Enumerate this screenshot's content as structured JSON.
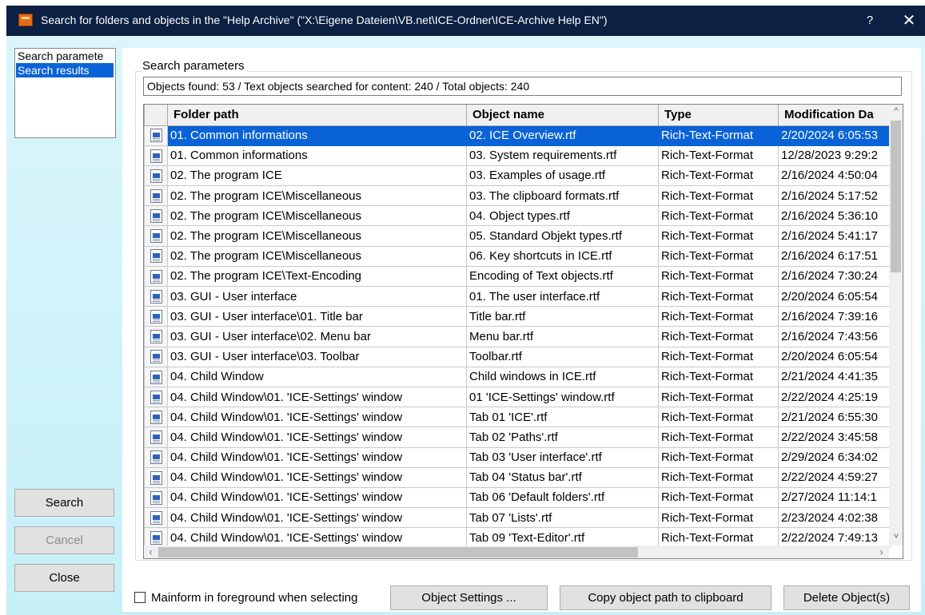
{
  "window": {
    "title": "Search for folders and objects in the \"Help Archive\" (\"X:\\Eigene Dateien\\VB.net\\ICE-Ordner\\ICE-Archive Help EN\")",
    "help_glyph": "?",
    "close_glyph": "✕"
  },
  "nav": {
    "items": [
      {
        "label": "Search paramete"
      },
      {
        "label": "Search results"
      }
    ],
    "selected_index": 1
  },
  "side_buttons": {
    "search": "Search",
    "cancel": "Cancel",
    "close": "Close"
  },
  "group_caption": "Search parameters",
  "status_line": "Objects found: 53 / Text objects searched for content: 240 / Total objects: 240",
  "table": {
    "columns": [
      "Folder path",
      "Object name",
      "Type",
      "Modification Da"
    ],
    "rows": [
      [
        "01. Common informations",
        "02. ICE Overview.rtf",
        "Rich-Text-Format",
        "2/20/2024 6:05:53"
      ],
      [
        "01. Common informations",
        "03. System requirements.rtf",
        "Rich-Text-Format",
        "12/28/2023 9:29:2"
      ],
      [
        "02. The program ICE",
        "03. Examples of usage.rtf",
        "Rich-Text-Format",
        "2/16/2024 4:50:04"
      ],
      [
        "02. The program ICE\\Miscellaneous",
        "03. The clipboard formats.rtf",
        "Rich-Text-Format",
        "2/16/2024 5:17:52"
      ],
      [
        "02. The program ICE\\Miscellaneous",
        "04. Object types.rtf",
        "Rich-Text-Format",
        "2/16/2024 5:36:10"
      ],
      [
        "02. The program ICE\\Miscellaneous",
        "05. Standard Objekt types.rtf",
        "Rich-Text-Format",
        "2/16/2024 5:41:17"
      ],
      [
        "02. The program ICE\\Miscellaneous",
        "06. Key shortcuts in ICE.rtf",
        "Rich-Text-Format",
        "2/16/2024 6:17:51"
      ],
      [
        "02. The program ICE\\Text-Encoding",
        "Encoding of Text objects.rtf",
        "Rich-Text-Format",
        "2/16/2024 7:30:24"
      ],
      [
        "03. GUI - User interface",
        "01. The user interface.rtf",
        "Rich-Text-Format",
        "2/20/2024 6:05:54"
      ],
      [
        "03. GUI - User interface\\01. Title bar",
        "Title bar.rtf",
        "Rich-Text-Format",
        "2/16/2024 7:39:16"
      ],
      [
        "03. GUI - User interface\\02. Menu bar",
        "Menu bar.rtf",
        "Rich-Text-Format",
        "2/16/2024 7:43:56"
      ],
      [
        "03. GUI - User interface\\03. Toolbar",
        "Toolbar.rtf",
        "Rich-Text-Format",
        "2/20/2024 6:05:54"
      ],
      [
        "04. Child Window",
        "Child windows in ICE.rtf",
        "Rich-Text-Format",
        "2/21/2024 4:41:35"
      ],
      [
        "04. Child Window\\01. 'ICE-Settings' window",
        "01 'ICE-Settings' window.rtf",
        "Rich-Text-Format",
        "2/22/2024 4:25:19"
      ],
      [
        "04. Child Window\\01. 'ICE-Settings' window",
        "Tab 01 'ICE'.rtf",
        "Rich-Text-Format",
        "2/21/2024 6:55:30"
      ],
      [
        "04. Child Window\\01. 'ICE-Settings' window",
        "Tab 02 'Paths'.rtf",
        "Rich-Text-Format",
        "2/22/2024 3:45:58"
      ],
      [
        "04. Child Window\\01. 'ICE-Settings' window",
        "Tab 03 'User interface'.rtf",
        "Rich-Text-Format",
        "2/29/2024 6:34:02"
      ],
      [
        "04. Child Window\\01. 'ICE-Settings' window",
        "Tab 04 'Status bar'.rtf",
        "Rich-Text-Format",
        "2/22/2024 4:59:27"
      ],
      [
        "04. Child Window\\01. 'ICE-Settings' window",
        "Tab 06 'Default folders'.rtf",
        "Rich-Text-Format",
        "2/27/2024 11:14:1"
      ],
      [
        "04. Child Window\\01. 'ICE-Settings' window",
        "Tab 07 'Lists'.rtf",
        "Rich-Text-Format",
        "2/23/2024 4:02:38"
      ],
      [
        "04. Child Window\\01. 'ICE-Settings' window",
        "Tab 09 'Text-Editor'.rtf",
        "Rich-Text-Format",
        "2/22/2024 7:49:13"
      ]
    ],
    "selected_row": 0,
    "row_icon": "rtf-document-icon"
  },
  "scroll": {
    "up": "^",
    "down": "˅",
    "left": "‹",
    "right": "›"
  },
  "checkbox": {
    "label": "Mainform in foreground when selecting",
    "checked": false
  },
  "bottom_buttons": {
    "object_settings": "Object Settings ...",
    "copy_path": "Copy object path to clipboard",
    "delete": "Delete Object(s)"
  },
  "colors": {
    "titlebar": "#0b2042",
    "selection": "#0a63d6",
    "client_background": "#d3f3f9"
  }
}
